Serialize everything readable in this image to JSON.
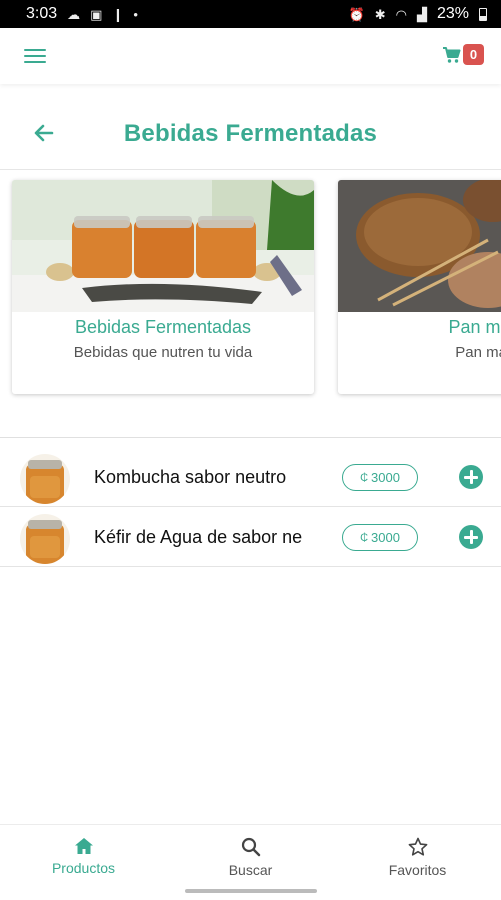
{
  "status_bar": {
    "time": "3:03",
    "battery": "23%"
  },
  "app_bar": {
    "cart_count": "0",
    "accent_color": "#3aaa91",
    "badge_color": "#d9534f"
  },
  "page": {
    "title": "Bebidas Fermentadas"
  },
  "categories": [
    {
      "title": "Bebidas Fermentadas",
      "description": "Bebidas que nutren tu vida",
      "image": "kombucha-jars-photo"
    },
    {
      "title": "Pan masa",
      "description": "Pan masa",
      "image": "sourdough-bread-photo"
    }
  ],
  "products": [
    {
      "name": "Kombucha sabor neutro",
      "currency": "₵",
      "price": "3000"
    },
    {
      "name": "Kéfir de Agua de sabor ne",
      "currency": "₵",
      "price": "3000"
    }
  ],
  "bottom_nav": {
    "items": [
      {
        "label": "Productos",
        "icon": "home-icon",
        "active": true
      },
      {
        "label": "Buscar",
        "icon": "search-icon",
        "active": false
      },
      {
        "label": "Favoritos",
        "icon": "star-icon",
        "active": false
      }
    ]
  }
}
